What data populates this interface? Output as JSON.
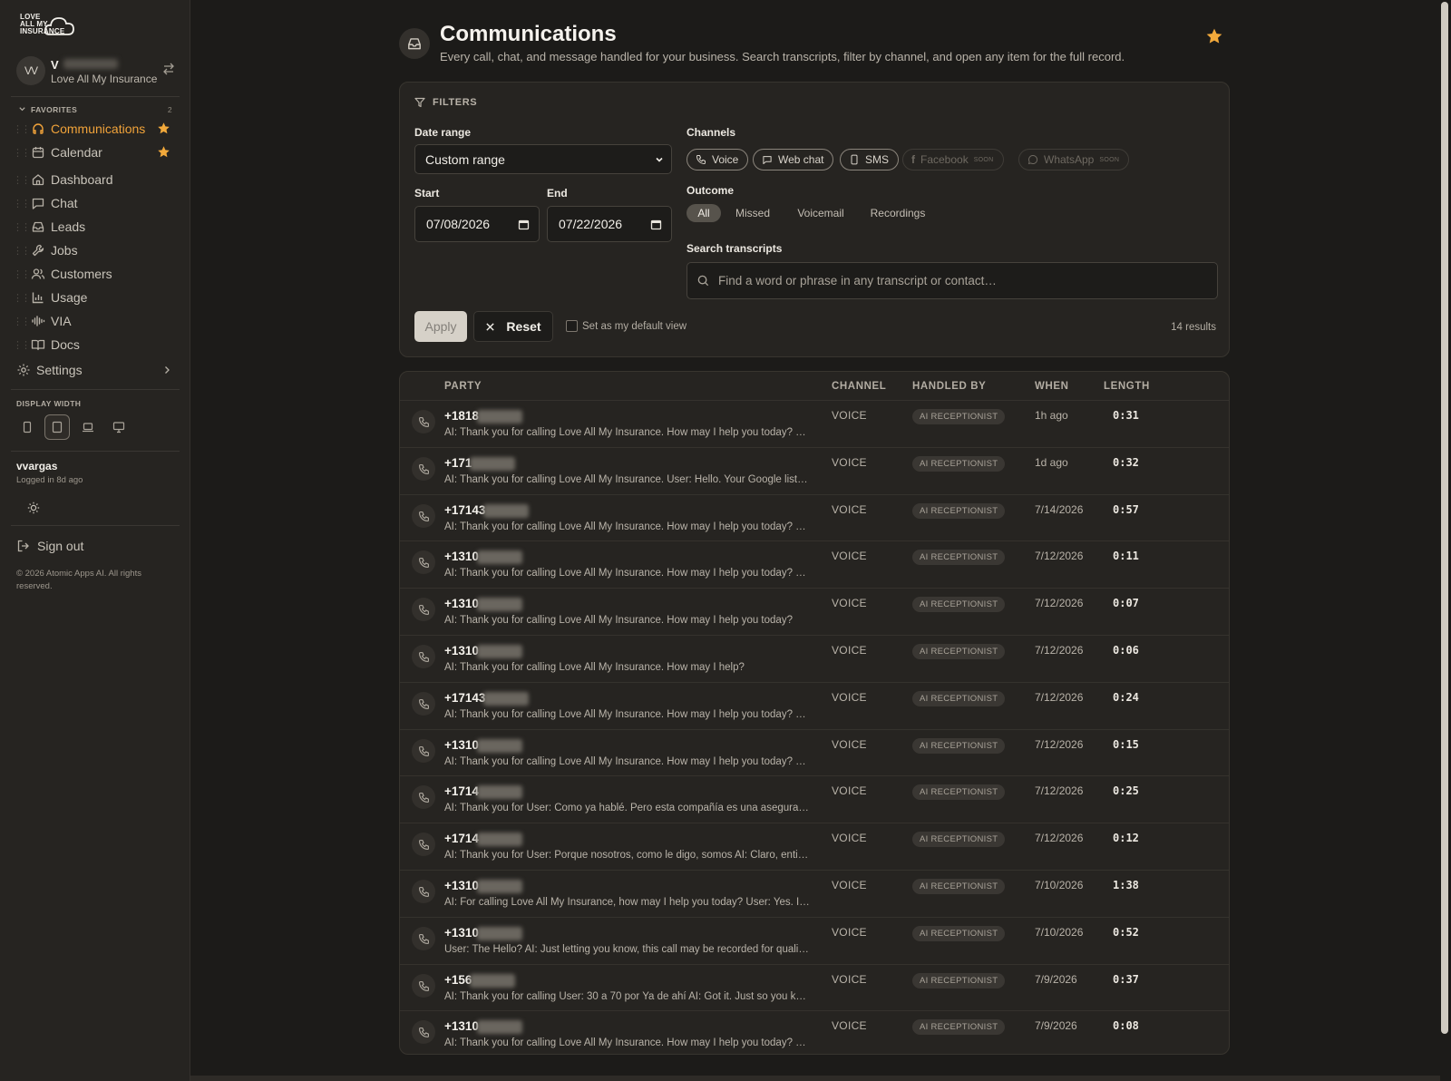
{
  "brand": {
    "logo_text": [
      "LOVE",
      "ALL MY",
      "INSURANCE"
    ]
  },
  "account": {
    "initials": "VV",
    "name": "V",
    "org": "Love All My Insurance"
  },
  "favorites": {
    "heading": "FAVORITES",
    "count": "2",
    "items": [
      {
        "label": "Communications",
        "icon": "headset-icon",
        "active": true
      },
      {
        "label": "Calendar",
        "icon": "calendar-icon",
        "active": false
      }
    ]
  },
  "nav": {
    "items": [
      {
        "label": "Dashboard",
        "icon": "home-icon"
      },
      {
        "label": "Chat",
        "icon": "chat-icon"
      },
      {
        "label": "Leads",
        "icon": "inbox-icon"
      },
      {
        "label": "Jobs",
        "icon": "wrench-icon"
      },
      {
        "label": "Customers",
        "icon": "users-icon"
      },
      {
        "label": "Usage",
        "icon": "bar-chart-icon"
      },
      {
        "label": "VIA",
        "icon": "waveform-icon"
      },
      {
        "label": "Docs",
        "icon": "book-icon"
      }
    ],
    "settings_label": "Settings"
  },
  "display_width": {
    "heading": "DISPLAY WIDTH"
  },
  "user": {
    "username": "vvargas",
    "last_login": "Logged in 8d ago"
  },
  "signout_label": "Sign out",
  "copyright": "© 2026 Atomic Apps AI. All rights reserved.",
  "page": {
    "title": "Communications",
    "subtitle": "Every call, chat, and message handled for your business. Search transcripts, filter by channel, and open any item for the full record."
  },
  "filters": {
    "heading": "FILTERS",
    "date_range_label": "Date range",
    "date_range_value": "Custom range",
    "start_label": "Start",
    "start_value": "07/08/2026",
    "end_label": "End",
    "end_value": "07/22/2026",
    "channels_label": "Channels",
    "channels": [
      {
        "label": "Voice",
        "icon": "phone-icon",
        "enabled": true
      },
      {
        "label": "Web chat",
        "icon": "chat-icon",
        "enabled": true
      },
      {
        "label": "SMS",
        "icon": "mobile-icon",
        "enabled": true
      },
      {
        "label": "Facebook",
        "icon": "facebook-icon",
        "enabled": false,
        "tag": "SOON"
      },
      {
        "label": "WhatsApp",
        "icon": "whatsapp-icon",
        "enabled": false,
        "tag": "SOON"
      }
    ],
    "outcome_label": "Outcome",
    "outcomes": [
      "All",
      "Missed",
      "Voicemail",
      "Recordings"
    ],
    "outcome_selected": "All",
    "search_label": "Search transcripts",
    "search_placeholder": "Find a word or phrase in any transcript or contact…",
    "apply_label": "Apply",
    "reset_label": "Reset",
    "default_view_label": "Set as my default view",
    "results_text": "14 results"
  },
  "table": {
    "columns": [
      "PARTY",
      "CHANNEL",
      "HANDLED BY",
      "WHEN",
      "LENGTH"
    ],
    "rows": [
      {
        "party": "+1818",
        "snippet": "AI: Thank you for calling Love All My Insurance. How may I help you today? Gra...",
        "channel": "VOICE",
        "handled_by": "AI RECEPTIONIST",
        "when": "1h ago",
        "length": "0:31"
      },
      {
        "party": "+171",
        "snippet": "AI: Thank you for calling Love All My Insurance. User: Hello. Your Google listing...",
        "channel": "VOICE",
        "handled_by": "AI RECEPTIONIST",
        "when": "1d ago",
        "length": "0:32"
      },
      {
        "party": "+17143",
        "snippet": "AI: Thank you for calling Love All My Insurance. How may I help you today? Gra...",
        "channel": "VOICE",
        "handled_by": "AI RECEPTIONIST",
        "when": "7/14/2026",
        "length": "0:57"
      },
      {
        "party": "+1310",
        "snippet": "AI: Thank you for calling Love All My Insurance. How may I help you today? Gra...",
        "channel": "VOICE",
        "handled_by": "AI RECEPTIONIST",
        "when": "7/12/2026",
        "length": "0:11"
      },
      {
        "party": "+1310",
        "snippet": "AI: Thank you for calling Love All My Insurance. How may I help you today?",
        "channel": "VOICE",
        "handled_by": "AI RECEPTIONIST",
        "when": "7/12/2026",
        "length": "0:07"
      },
      {
        "party": "+1310",
        "snippet": "AI: Thank you for calling Love All My Insurance. How may I help?",
        "channel": "VOICE",
        "handled_by": "AI RECEPTIONIST",
        "when": "7/12/2026",
        "length": "0:06"
      },
      {
        "party": "+17143",
        "snippet": "AI: Thank you for calling Love All My Insurance. How may I help you today? Gra...",
        "channel": "VOICE",
        "handled_by": "AI RECEPTIONIST",
        "when": "7/12/2026",
        "length": "0:24"
      },
      {
        "party": "+1310",
        "snippet": "AI: Thank you for calling Love All My Insurance. How may I help you today? Par...",
        "channel": "VOICE",
        "handled_by": "AI RECEPTIONIST",
        "when": "7/12/2026",
        "length": "0:15"
      },
      {
        "party": "+1714",
        "snippet": "AI: Thank you for User: Como ya hablé. Pero esta compañía es una aseguranz...",
        "channel": "VOICE",
        "handled_by": "AI RECEPTIONIST",
        "when": "7/12/2026",
        "length": "0:25"
      },
      {
        "party": "+1714",
        "snippet": "AI: Thank you for User: Porque nosotros, como le digo, somos AI: Claro, entie...",
        "channel": "VOICE",
        "handled_by": "AI RECEPTIONIST",
        "when": "7/12/2026",
        "length": "0:12"
      },
      {
        "party": "+1310",
        "snippet": "AI: For calling Love All My Insurance, how may I help you today? User: Yes. I'd li...",
        "channel": "VOICE",
        "handled_by": "AI RECEPTIONIST",
        "when": "7/10/2026",
        "length": "1:38"
      },
      {
        "party": "+1310",
        "snippet": "User: The Hello? AI: Just letting you know, this call may be recorded for qualit...",
        "channel": "VOICE",
        "handled_by": "AI RECEPTIONIST",
        "when": "7/10/2026",
        "length": "0:52"
      },
      {
        "party": "+156",
        "snippet": "AI: Thank you for calling User: 30 a 70 por Ya de ahí AI: Got it. Just so you know...",
        "channel": "VOICE",
        "handled_by": "AI RECEPTIONIST",
        "when": "7/9/2026",
        "length": "0:37"
      },
      {
        "party": "+1310",
        "snippet": "AI: Thank you for calling Love All My Insurance. How may I help you today? Gra...",
        "channel": "VOICE",
        "handled_by": "AI RECEPTIONIST",
        "when": "7/9/2026",
        "length": "0:08"
      }
    ]
  },
  "colors": {
    "accent": "#f1a33a",
    "star": "#f2a93b",
    "background": "#1c1b19",
    "panel": "#262421"
  }
}
